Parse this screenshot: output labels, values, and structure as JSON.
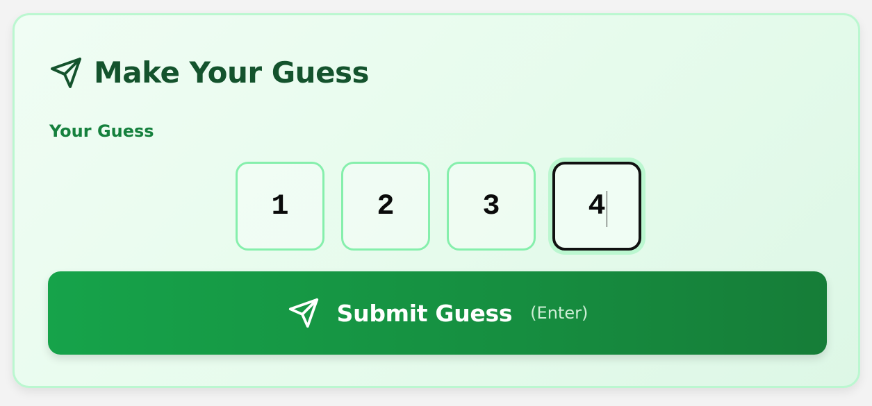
{
  "card": {
    "title": "Make Your Guess",
    "title_icon": "send-icon",
    "label": "Your Guess",
    "digits": [
      "1",
      "2",
      "3",
      "4"
    ],
    "active_digit_index": 3,
    "submit": {
      "label": "Submit Guess",
      "hint": "(Enter)",
      "icon": "send-icon"
    }
  },
  "colors": {
    "title": "#14532d",
    "label": "#15803d",
    "digit_border": "#86efac",
    "button_start": "#16a34a",
    "button_end": "#167d38",
    "card_border": "#bbf7d0"
  }
}
